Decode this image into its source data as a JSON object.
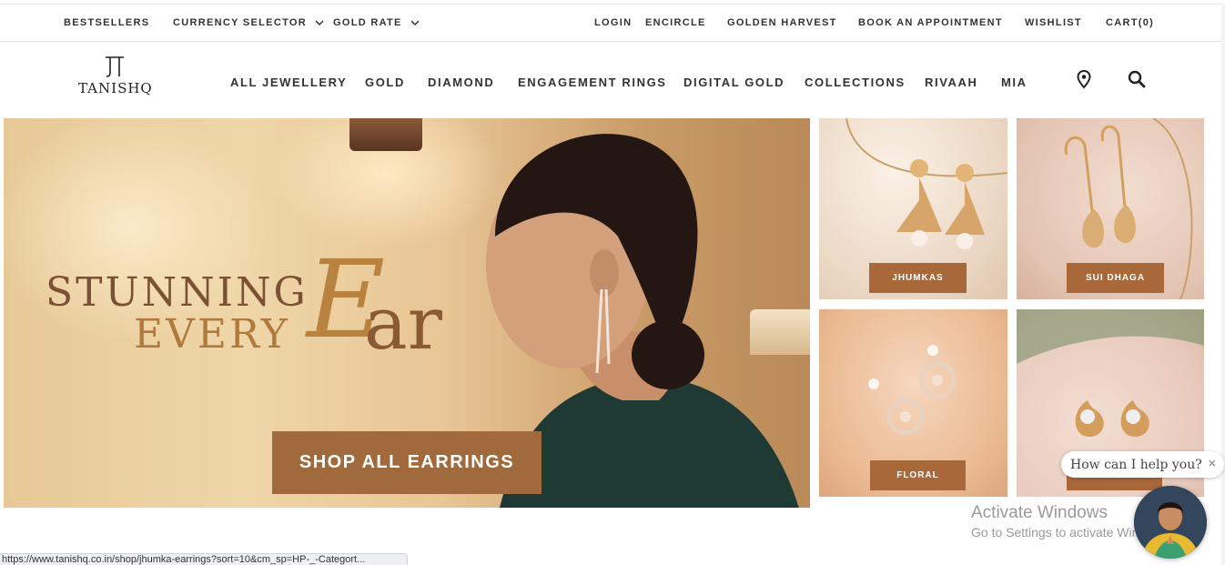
{
  "topbar": {
    "bestsellers": "BESTSELLERS",
    "currency_selector": "CURRENCY SELECTOR",
    "gold_rate": "GOLD RATE",
    "login": "LOGIN",
    "encircle": "ENCIRCLE",
    "golden_harvest": "GOLDEN HARVEST",
    "book_appointment": "BOOK AN APPOINTMENT",
    "wishlist": "WISHLIST",
    "cart": "CART(0)"
  },
  "brand": {
    "logo_text": "TANISHQ"
  },
  "nav": {
    "items": [
      "ALL JEWELLERY",
      "GOLD",
      "DIAMOND",
      "ENGAGEMENT RINGS",
      "DIGITAL GOLD",
      "COLLECTIONS",
      "RIVAAH",
      "MIA"
    ],
    "icons": [
      "location-pin-icon",
      "search-icon"
    ]
  },
  "hero": {
    "line1": "STUNNING",
    "line2": "EVERY",
    "big_letter": "E",
    "big_rest": "ar",
    "cta": "SHOP ALL EARRINGS"
  },
  "tiles": [
    {
      "label": "JHUMKAS"
    },
    {
      "label": "SUI DHAGA"
    },
    {
      "label": "FLORAL"
    },
    {
      "label": "STUDS"
    }
  ],
  "chat": {
    "prompt": "How can I help you?",
    "close": "×"
  },
  "watermark": {
    "title": "Activate Windows",
    "subtitle": "Go to Settings to activate Windows."
  },
  "statusbar": {
    "url": "https://www.tanishq.co.in/shop/jhumka-earrings?sort=10&cm_sp=HP-_-Categort..."
  },
  "colors": {
    "accent": "#a8683a",
    "hero_cta": "#a06a3d"
  }
}
